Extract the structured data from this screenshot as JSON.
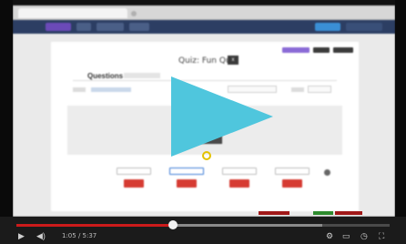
{
  "colors": {
    "accent_play": "#4fc6dd",
    "progress_red": "#cc1b1b",
    "nav_bg": "#2c3e63",
    "delete_red": "#d63b32"
  },
  "quiz_page": {
    "title": "Quiz: Fun Quiz",
    "title_badge": "x",
    "question_heading": "Questions 1"
  },
  "answers": [
    {
      "label": "",
      "selected": false
    },
    {
      "label": "",
      "selected": true
    },
    {
      "label": "",
      "selected": false
    },
    {
      "label": "",
      "selected": false
    }
  ],
  "player": {
    "play_icon": "play-icon",
    "progress": 0.42,
    "buffered": 0.82,
    "controls": {
      "play": "▶",
      "volume": "◀)",
      "settings": "⚙",
      "captions": "▭",
      "watch_later": "◷",
      "fullscreen": "⛶"
    },
    "time": "1:05 / 5:37"
  }
}
